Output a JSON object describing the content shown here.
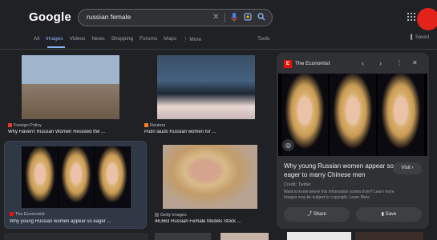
{
  "logo": "Google",
  "search": {
    "query": "russian female"
  },
  "tabs": [
    "All",
    "Images",
    "Videos",
    "News",
    "Shopping",
    "Forums",
    "Maps",
    "⋮ More"
  ],
  "tools_label": "Tools",
  "saved_label": "Saved",
  "results": [
    {
      "source": "Foreign Policy",
      "title": "Why Haven't Russian Women Resisted the ...",
      "src_color": "#e23b2a"
    },
    {
      "source": "Reuters",
      "title": "Putin lauds Russian women for ...",
      "src_color": "#f58025"
    },
    {
      "source": "The Economist",
      "title": "Why young Russian women appear so eager ...",
      "src_color": "#e3120b"
    },
    {
      "source": "Getty Images",
      "title": "46,663 Russian Female Models Stock ...",
      "src_color": "#5f6368"
    }
  ],
  "panel": {
    "source": "The Economist",
    "logo_letter": "E",
    "title_line1": "Why young Russian women appear so",
    "title_line2": "eager to marry Chinese men",
    "visit_label": "Visit",
    "credit": "Credit: Twitter",
    "note_line1": "Want to know where this information comes from? Learn more",
    "note_line2": "Images may be subject to copyright. Learn More",
    "share_label": "Share",
    "save_label": "Save"
  }
}
